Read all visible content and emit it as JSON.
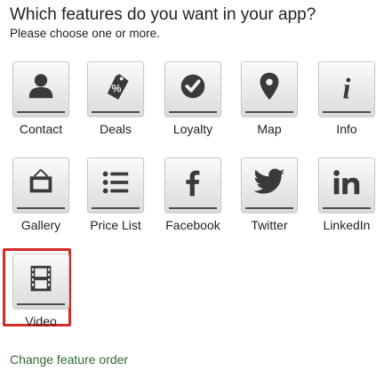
{
  "header": {
    "title": "Which features do you want in your app?",
    "subtitle": "Please choose one or more."
  },
  "features": [
    {
      "label": "Contact",
      "icon": "person-icon"
    },
    {
      "label": "Deals",
      "icon": "price-tag-icon"
    },
    {
      "label": "Loyalty",
      "icon": "checkmark-circle-icon"
    },
    {
      "label": "Map",
      "icon": "map-pin-icon"
    },
    {
      "label": "Info",
      "icon": "info-icon"
    },
    {
      "label": "Gallery",
      "icon": "picture-frame-icon"
    },
    {
      "label": "Price List",
      "icon": "list-icon"
    },
    {
      "label": "Facebook",
      "icon": "facebook-icon"
    },
    {
      "label": "Twitter",
      "icon": "twitter-bird-icon"
    },
    {
      "label": "LinkedIn",
      "icon": "linkedin-icon"
    },
    {
      "label": "Video",
      "icon": "film-strip-icon",
      "selected": true
    }
  ],
  "footer": {
    "change_order_link": "Change feature order"
  },
  "colors": {
    "icon": "#3a3a3a",
    "selection_border": "#d42a2a",
    "link": "#2d6b2d"
  }
}
